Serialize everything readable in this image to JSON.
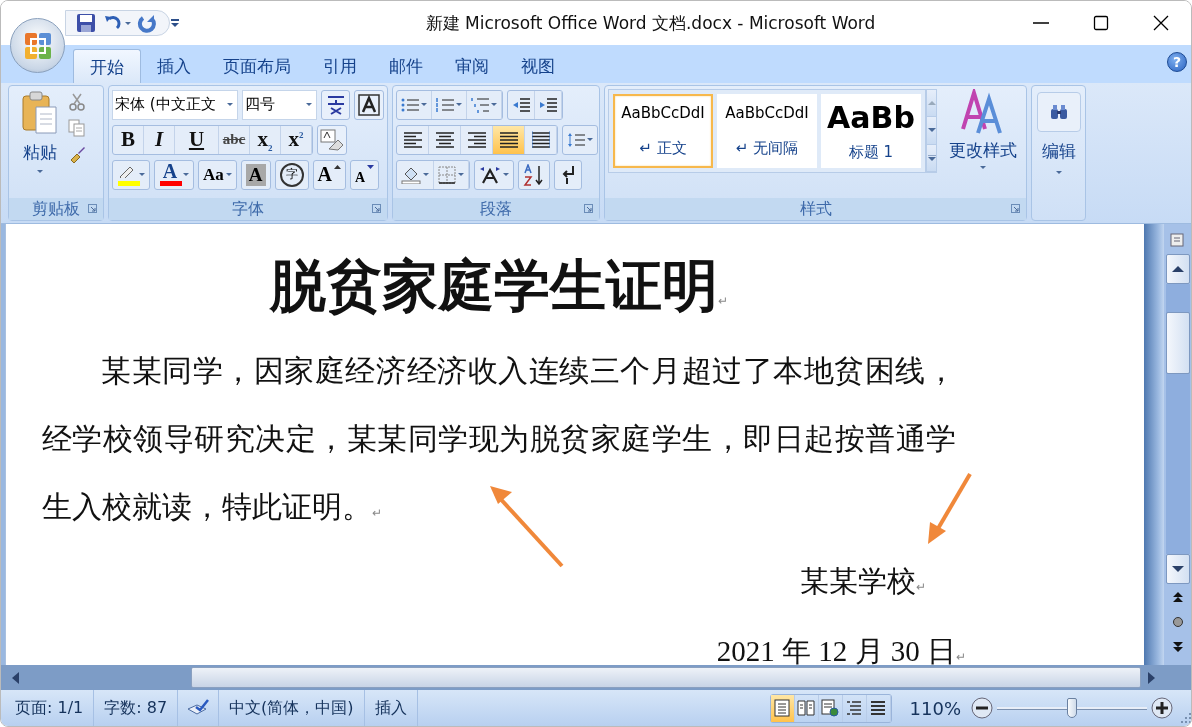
{
  "window": {
    "title": "新建 Microsoft Office Word 文档.docx - Microsoft Word"
  },
  "tabs": [
    {
      "label": "开始",
      "selected": true
    },
    {
      "label": "插入",
      "selected": false
    },
    {
      "label": "页面布局",
      "selected": false
    },
    {
      "label": "引用",
      "selected": false
    },
    {
      "label": "邮件",
      "selected": false
    },
    {
      "label": "审阅",
      "selected": false
    },
    {
      "label": "视图",
      "selected": false
    }
  ],
  "ribbon": {
    "clipboard": {
      "paste_label": "粘贴",
      "group_label": "剪贴板"
    },
    "font": {
      "font_name": "宋体 (中文正文",
      "font_size": "四号",
      "format_buttons": [
        "B",
        "I",
        "U",
        "abc",
        "x$_{2}$",
        "x$^{2}$"
      ],
      "color_buttons": [
        {
          "kind": "highlight",
          "color": "#ffff00"
        },
        {
          "kind": "fontcolor",
          "label": "A",
          "color": "#ff0000"
        },
        {
          "kind": "case",
          "label": "Aa"
        },
        {
          "kind": "shade",
          "label": "A"
        },
        {
          "kind": "enclose",
          "label": "字"
        },
        {
          "kind": "grow",
          "label": "A"
        },
        {
          "kind": "shrink",
          "label": "A"
        }
      ],
      "group_label": "字体"
    },
    "paragraph": {
      "alignment": [
        {
          "kind": "left",
          "selected": false
        },
        {
          "kind": "center",
          "selected": false
        },
        {
          "kind": "right",
          "selected": false
        },
        {
          "kind": "justify",
          "selected": true
        },
        {
          "kind": "distributed",
          "selected": false
        }
      ],
      "group_label": "段落"
    },
    "styles": {
      "gallery": [
        {
          "kind": "normal",
          "preview": "AaBbCcDdI",
          "name": "↵ 正文",
          "selected": true
        },
        {
          "kind": "normal",
          "preview": "AaBbCcDdI",
          "name": "↵ 无间隔",
          "selected": false
        },
        {
          "kind": "heading",
          "preview": "AaBb",
          "name": "标题 1",
          "selected": false
        }
      ],
      "change_styles": "更改样式",
      "group_label": "样式"
    },
    "editing": {
      "label": "编辑"
    },
    "help": "?"
  },
  "document": {
    "title": "脱贫家庭学生证明",
    "paragraph": "某某同学，因家庭经济经济收入连续三个月超过了本地贫困线，经学校领导研究决定，某某同学现为脱贫家庭学生，即日起按普通学生入校就读，特此证明。",
    "signature": "某某学校",
    "date": "2021 年 12 月 30 日",
    "mark": "↵"
  },
  "status_bar": {
    "page": "页面: 1/1",
    "words": "字数: 87",
    "language": "中文(简体，中国)",
    "mode": "插入",
    "views": [
      {
        "kind": "print",
        "selected": true
      },
      {
        "kind": "reading",
        "selected": false
      },
      {
        "kind": "web",
        "selected": false
      },
      {
        "kind": "outline",
        "selected": false
      },
      {
        "kind": "draft",
        "selected": false
      }
    ],
    "zoom": "110%",
    "zoom_level": {
      "level": 0.5
    }
  }
}
